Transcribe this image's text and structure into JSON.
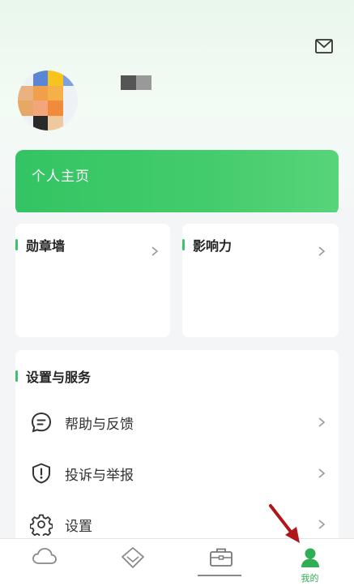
{
  "header": {
    "mail_icon": "mail-icon"
  },
  "profile": {
    "avatar_icon": "pixelated-avatar",
    "username_masked": ""
  },
  "home_card": {
    "label": "个人主页"
  },
  "cards": {
    "medals": {
      "title": "勋章墙"
    },
    "influence": {
      "title": "影响力"
    }
  },
  "settings_section": {
    "title": "设置与服务",
    "items": [
      {
        "label": "帮助与反馈",
        "icon": "chat-help-icon"
      },
      {
        "label": "投诉与举报",
        "icon": "shield-alert-icon"
      },
      {
        "label": "设置",
        "icon": "gear-icon"
      }
    ]
  },
  "tabbar": {
    "tabs": [
      {
        "label": "",
        "icon": "cloud-icon",
        "active": false
      },
      {
        "label": "",
        "icon": "diamond-icon",
        "active": false
      },
      {
        "label": "",
        "icon": "briefcase-icon",
        "active": false
      },
      {
        "label": "我的",
        "icon": "person-icon",
        "active": true
      }
    ]
  },
  "colors": {
    "accent": "#3cc466",
    "tab_active": "#2fae56",
    "annotation_arrow": "#b0171b"
  }
}
